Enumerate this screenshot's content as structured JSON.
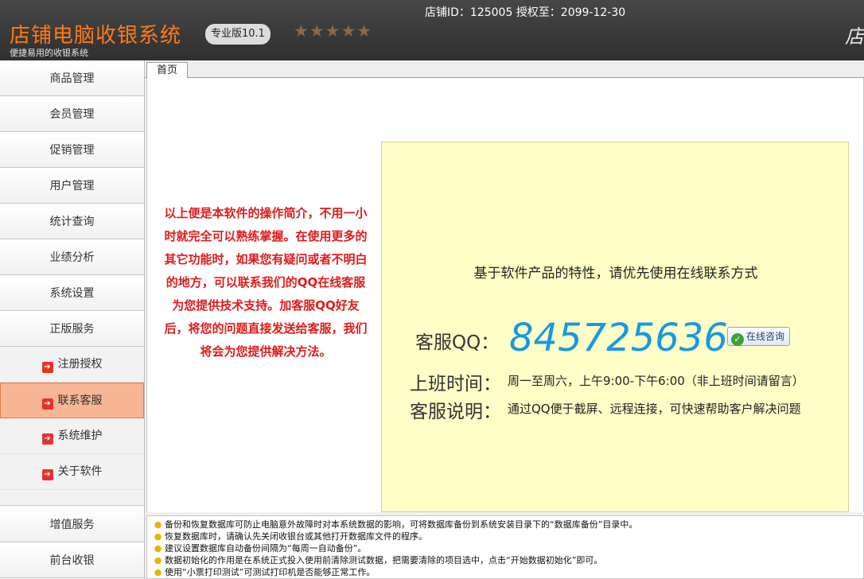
{
  "header": {
    "title": "店铺电脑收银系统",
    "subtitle": "便捷易用的收银系统",
    "edition": "专业版10.1",
    "rating": {
      "stars": 5,
      "text": "★★★★★"
    },
    "store_id_text": "店铺ID：125005",
    "license_text": "授权至：2099-12-30",
    "brand_right": "店"
  },
  "sidebar": {
    "items": [
      {
        "label": "商品管理"
      },
      {
        "label": "会员管理"
      },
      {
        "label": "促销管理"
      },
      {
        "label": "用户管理"
      },
      {
        "label": "统计查询"
      },
      {
        "label": "业绩分析"
      },
      {
        "label": "系统设置"
      },
      {
        "label": "正版服务"
      }
    ],
    "sub_items": [
      {
        "label": "注册授权",
        "icon": "red-arrow-icon"
      },
      {
        "label": "联系客服",
        "icon": "red-arrow-icon",
        "active": true
      },
      {
        "label": "系统维护",
        "icon": "red-arrow-icon"
      },
      {
        "label": "关于软件",
        "icon": "red-arrow-icon"
      }
    ],
    "bottom_items": [
      {
        "label": "增值服务"
      },
      {
        "label": "前台收银"
      }
    ]
  },
  "tabs": [
    {
      "label": "首页"
    }
  ],
  "main": {
    "intro_text": "以上便是本软件的操作简介，不用一小时就完全可以熟练掌握。在使用更多的其它功能时，如果您有疑问或者不明白的地方，可以联系我们的QQ在线客服为您提供技术支持。加客服QQ好友后，将您的问题直接发送给客服，我们将会为您提供解决方法。",
    "contact": {
      "intro": "基于软件产品的特性，请优先使用在线联系方式",
      "qq_label": "客服QQ：",
      "qq_number": "845725636",
      "online_button": "在线咨询",
      "hours_label": "上班时间：",
      "hours_value": "周一至周六，上午9:00-下午6:00（非上班时间请留言）",
      "desc_label": "客服说明：",
      "desc_value": "通过QQ便于截屏、远程连接，可快速帮助客户解决问题"
    }
  },
  "tips": [
    "备份和恢复数据库可防止电脑意外故障时对本系统数据的影响，可将数据库备份到系统安装目录下的“数据库备份”目录中。",
    "恢复数据库时，请确认先关闭收银台或其他打开数据库文件的程序。",
    "建议设置数据库自动备份间隔为“每周一自动备份”。",
    "数据初始化的作用是在系统正式投入使用前清除测试数据，把需要清除的项目选中，点击“开始数据初始化”即可。",
    "使用“小票打印测试”可测试打印机是否能够正常工作。"
  ],
  "colors": {
    "header_bg": "#3a3a3a",
    "title": "#ff7a1a",
    "active_item": "#f7b594",
    "intro_text": "#e01a1a",
    "panel_bg": "#fefec6",
    "qq_number": "#1a98e0"
  }
}
